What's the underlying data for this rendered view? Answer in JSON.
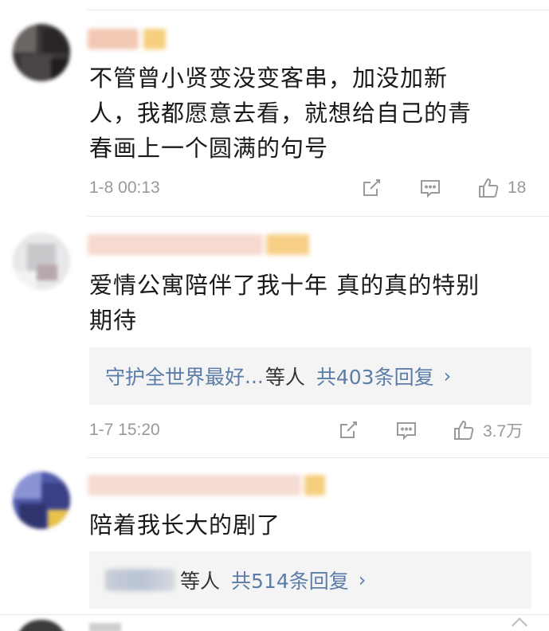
{
  "comments": [
    {
      "text_line1": "不管曾小贤变没变客串，加没加新",
      "text_line2": "人，我都愿意去看，就想给自己的青",
      "text_line3": "春画上一个圆满的句号",
      "timestamp": "1-8 00:13",
      "likes": "18",
      "actions": [
        "share-icon",
        "comment-icon",
        "like-icon"
      ]
    },
    {
      "text_line1": "爱情公寓陪伴了我十年 真的真的特别",
      "text_line2": "期待",
      "reply": {
        "name": "守护全世界最好",
        "ellipsis": "...",
        "suffix": "等人",
        "total": "共403条回复",
        "chevron": "›"
      },
      "timestamp": "1-7 15:20",
      "likes": "3.7万",
      "actions": [
        "share-icon",
        "comment-icon",
        "like-icon"
      ]
    },
    {
      "text_line1": "陪着我长大的剧了",
      "reply": {
        "suffix": "等人",
        "total": "共514条回复",
        "chevron": "›"
      }
    }
  ],
  "colors": {
    "link": "#5b7da8",
    "meta": "#999999",
    "reply_bg": "#f4f4f4",
    "divider": "#e8e8e8"
  }
}
